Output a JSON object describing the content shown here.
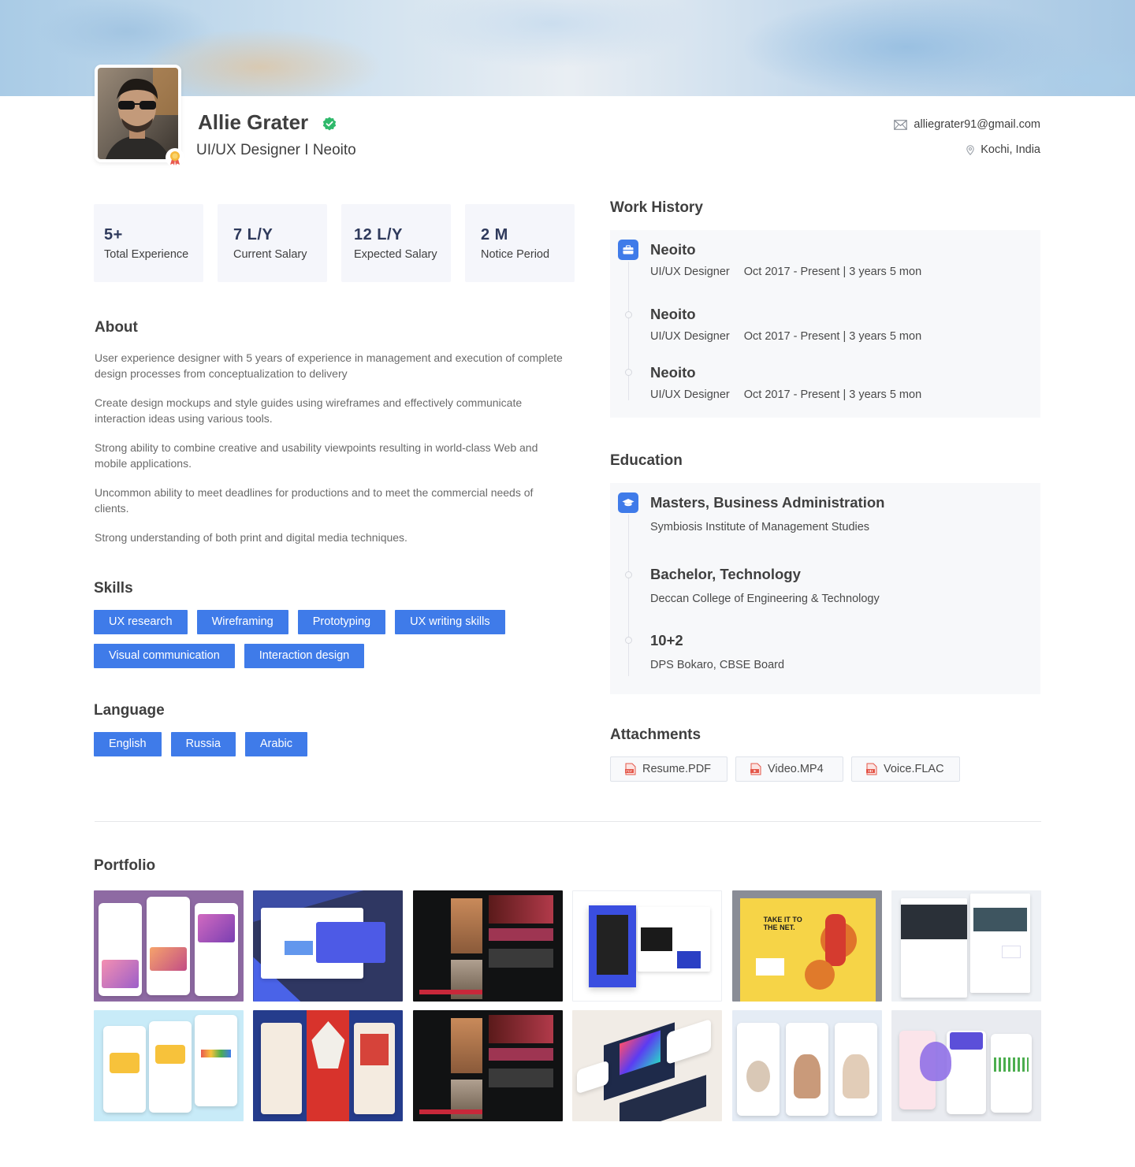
{
  "profile": {
    "name": "Allie Grater",
    "title": "UI/UX Designer I Neoito",
    "email": "alliegrater91@gmail.com",
    "location": "Kochi, India"
  },
  "stats": [
    {
      "value": "5+",
      "label": "Total Experience"
    },
    {
      "value": "7 L/Y",
      "label": "Current Salary"
    },
    {
      "value": "12 L/Y",
      "label": "Expected Salary"
    },
    {
      "value": "2 M",
      "label": "Notice Period"
    }
  ],
  "about": {
    "title": "About",
    "paragraphs": [
      "User experience designer with 5 years of experience in management and execution of complete design processes from conceptualization to delivery",
      "Create design mockups and style guides using wireframes and effectively communicate interaction ideas using various tools.",
      "Strong ability to combine creative and usability viewpoints resulting in world-class Web and mobile applications.",
      "Uncommon ability to meet deadlines for productions and to meet the commercial needs of clients.",
      "Strong understanding of both print and digital media techniques."
    ]
  },
  "skills": {
    "title": "Skills",
    "items": [
      "UX research",
      "Wireframing",
      "Prototyping",
      "UX writing skills",
      "Visual communication",
      "Interaction design"
    ]
  },
  "language": {
    "title": "Language",
    "items": [
      "English",
      "Russia",
      "Arabic"
    ]
  },
  "work_history": {
    "title": "Work History",
    "items": [
      {
        "company": "Neoito",
        "role": "UI/UX Designer",
        "period": "Oct 2017 - Present  |  3 years 5 mon"
      },
      {
        "company": "Neoito",
        "role": "UI/UX Designer",
        "period": "Oct 2017 - Present  |  3 years 5 mon"
      },
      {
        "company": "Neoito",
        "role": "UI/UX Designer",
        "period": "Oct 2017 - Present  |  3 years 5 mon"
      }
    ]
  },
  "education": {
    "title": "Education",
    "items": [
      {
        "degree": "Masters, Business Administration",
        "school": "Symbiosis Institute of Management Studies"
      },
      {
        "degree": "Bachelor, Technology",
        "school": "Deccan College of Engineering & Technology"
      },
      {
        "degree": "10+2",
        "school": "DPS Bokaro, CBSE Board"
      }
    ]
  },
  "attachments": {
    "title": "Attachments",
    "items": [
      "Resume.PDF",
      "Video.MP4",
      "Voice.FLAC"
    ]
  },
  "portfolio": {
    "title": "Portfolio"
  },
  "colors": {
    "accent": "#3f7be9",
    "verified": "#2fb96b",
    "card_bg": "#f5f6fb"
  }
}
